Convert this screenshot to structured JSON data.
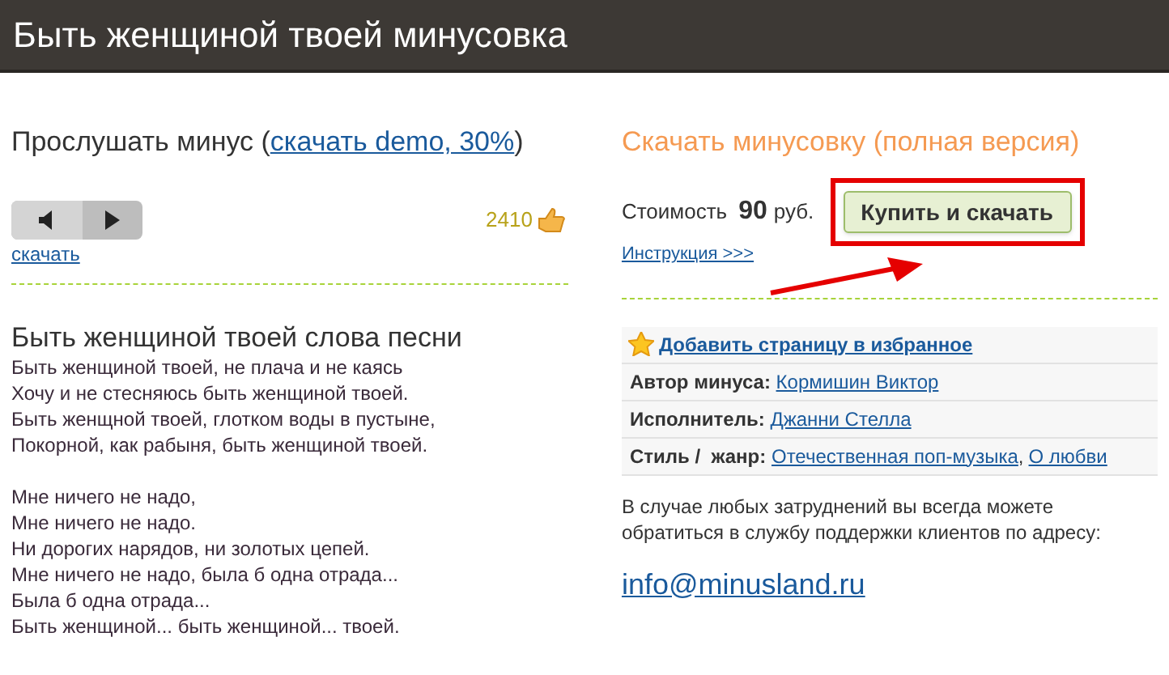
{
  "header": {
    "title": "Быть женщиной твоей минусовка"
  },
  "listen": {
    "label": "Прослушать минус",
    "open_paren": "(",
    "demo_link": "скачать demo, 30%",
    "close_paren": ")",
    "download_link": "скачать",
    "count": "2410"
  },
  "buy": {
    "title": "Скачать минусовку (полная версия)",
    "price_label": "Стоимость",
    "price": "90",
    "currency": "руб.",
    "button": "Купить и скачать",
    "instruction_link": "Инструкция >>>"
  },
  "lyrics": {
    "title": "Быть женщиной твоей слова песни",
    "stanzas": [
      [
        "Быть женщиной твоей, не плача и не каясь",
        "Хочу и не стесняюсь быть женщиной твоей.",
        "Быть женщной твоей, глотком воды в пустыне,",
        "Покорной, как рабыня, быть женщиной твоей."
      ],
      [
        "Мне ничего не надо,",
        "Мне ничего не надо.",
        "Ни дорогих нарядов, ни золотых цепей.",
        "Мне ничего не надо, была б одна отрада...",
        "Была б одна отрада...",
        "Быть женщиной... быть женщиной... твоей."
      ]
    ]
  },
  "info": {
    "favorite_link": "Добавить страницу в избранное",
    "separator": ",",
    "rows": [
      {
        "label": "Автор минуса:",
        "links": [
          "Кормишин Виктор"
        ]
      },
      {
        "label": "Исполнитель:",
        "links": [
          "Джанни Стелла"
        ]
      },
      {
        "label": "Стиль /  жанр:",
        "links": [
          "Отечественная поп-музыка",
          "О любви"
        ]
      }
    ]
  },
  "support": {
    "text": "В случае любых затруднений вы всегда можете обратиться в службу поддержки клиентов по адресу:",
    "email": "info@minusland.ru"
  }
}
